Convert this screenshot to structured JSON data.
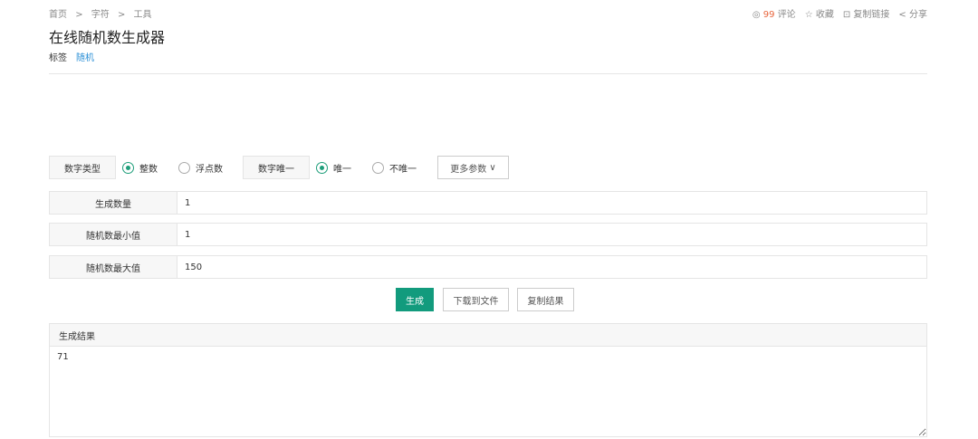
{
  "breadcrumb": [
    "首页",
    ">",
    "字符",
    ">",
    "工具"
  ],
  "title": "在线随机数生成器",
  "tags": {
    "label": "标签",
    "items": [
      "随机"
    ]
  },
  "actions": {
    "comment_count": "99",
    "comment": "评论",
    "favorite": "收藏",
    "copy_link": "复制链接",
    "share": "分享"
  },
  "options": {
    "type_label": "数字类型",
    "type_options": [
      "整数",
      "浮点数"
    ],
    "type_selected": 0,
    "unique_label": "数字唯一",
    "unique_options": [
      "唯一",
      "不唯一"
    ],
    "unique_selected": 0,
    "more": "更多参数"
  },
  "fields": [
    {
      "label": "生成数量",
      "value": "1"
    },
    {
      "label": "随机数最小值",
      "value": "1"
    },
    {
      "label": "随机数最大值",
      "value": "150"
    }
  ],
  "buttons": {
    "generate": "生成",
    "download": "下载到文件",
    "copy": "复制结果"
  },
  "result": {
    "label": "生成结果",
    "value": "71"
  },
  "colors": {
    "accent": "#129b7d",
    "link": "#2a8fd6",
    "count": "#e8663d"
  }
}
